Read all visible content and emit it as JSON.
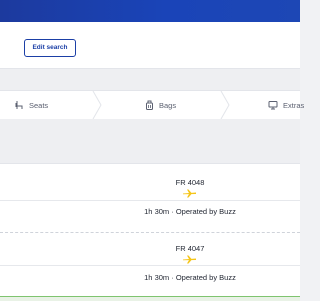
{
  "header": {
    "brand_color": "#1a44b8"
  },
  "subheader": {
    "edit_search_label": "Edit search"
  },
  "steps": [
    {
      "label": "Seats",
      "icon": "seat-icon"
    },
    {
      "label": "Bags",
      "icon": "bag-icon"
    },
    {
      "label": "Extras",
      "icon": "extras-icon"
    }
  ],
  "flights": [
    {
      "number": "FR 4048",
      "duration_operator": "1h 30m · Operated by Buzz",
      "icon": "plane-icon"
    },
    {
      "number": "FR 4047",
      "duration_operator": "1h 30m · Operated by Buzz",
      "icon": "plane-icon"
    }
  ],
  "colors": {
    "accent_yellow": "#f5c518",
    "link_blue": "#1b3fa6",
    "success_green": "#7fc46f"
  }
}
